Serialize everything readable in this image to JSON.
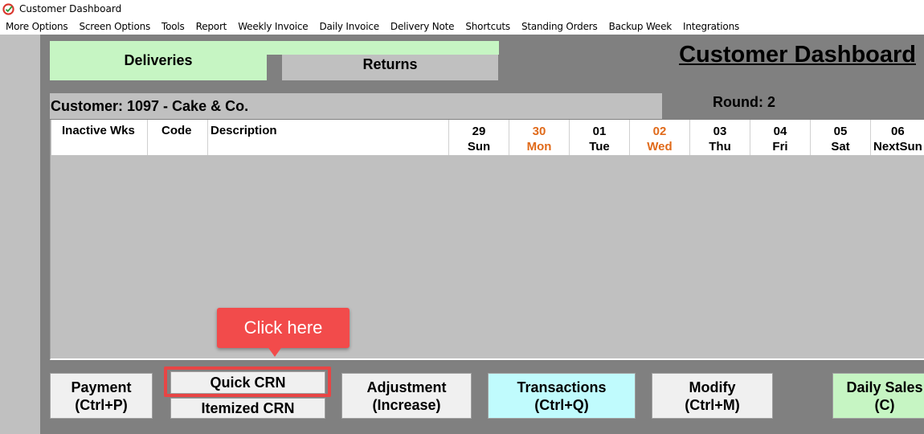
{
  "window": {
    "title": "Customer Dashboard",
    "icon": "app-logo-icon"
  },
  "menu": [
    "More Options",
    "Screen Options",
    "Tools",
    "Report",
    "Weekly Invoice",
    "Daily Invoice",
    "Delivery Note",
    "Shortcuts",
    "Standing Orders",
    "Backup Week",
    "Integrations"
  ],
  "tabs": {
    "deliveries": "Deliveries",
    "returns": "Returns",
    "active": "Deliveries"
  },
  "dashboard_title": "Customer Dashboard",
  "customer": {
    "label": "Customer: 1097 - Cake & Co.",
    "round": "Round: 2"
  },
  "grid": {
    "columns": {
      "inactive": "Inactive Wks",
      "code": "Code",
      "description": "Description"
    },
    "days": [
      {
        "num": "29",
        "name": "Sun",
        "highlight": false
      },
      {
        "num": "30",
        "name": "Mon",
        "highlight": true
      },
      {
        "num": "01",
        "name": "Tue",
        "highlight": false
      },
      {
        "num": "02",
        "name": "Wed",
        "highlight": true
      },
      {
        "num": "03",
        "name": "Thu",
        "highlight": false
      },
      {
        "num": "04",
        "name": "Fri",
        "highlight": false
      },
      {
        "num": "05",
        "name": "Sat",
        "highlight": false
      },
      {
        "num": "06",
        "name": "NextSun",
        "highlight": false
      }
    ],
    "rows": []
  },
  "buttons": {
    "payment": [
      "Payment",
      "(Ctrl+P)"
    ],
    "quick_crn": "Quick CRN",
    "itemized_crn": "Itemized CRN",
    "adjustment": [
      "Adjustment",
      "(Increase)"
    ],
    "transactions": [
      "Transactions",
      "(Ctrl+Q)"
    ],
    "modify": [
      "Modify",
      "(Ctrl+M)"
    ],
    "daily_sales": [
      "Daily Sales",
      "(C)"
    ]
  },
  "callout": {
    "text": "Click here"
  },
  "colors": {
    "highlight_day": "#e06a1a",
    "callout": "#f24b4b",
    "deliveries_tab": "#c6f5c3",
    "transactions_btn": "#c0fbfd"
  }
}
